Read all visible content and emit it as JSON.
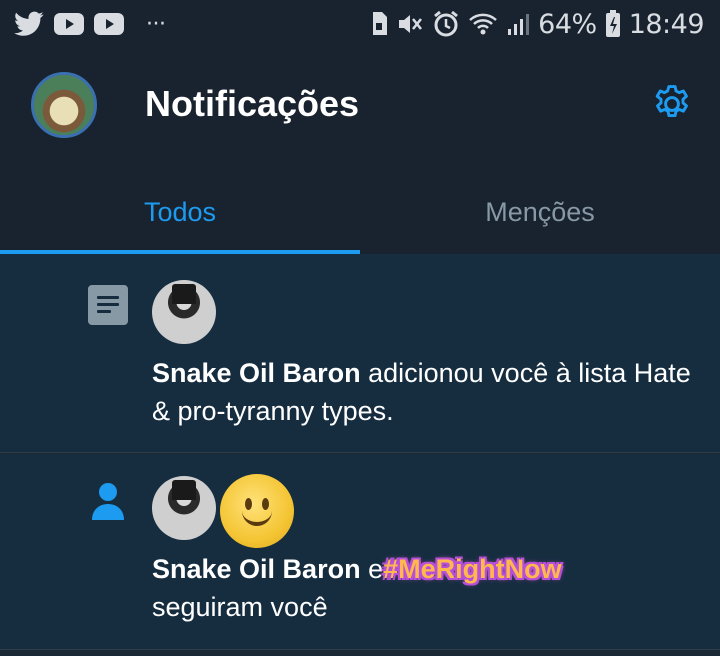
{
  "status_bar": {
    "battery_percent": "64%",
    "time": "18:49",
    "dots": "···"
  },
  "header": {
    "title": "Notificações",
    "tabs": [
      {
        "label": "Todos",
        "active": true
      },
      {
        "label": "Menções",
        "active": false
      }
    ]
  },
  "notifications": [
    {
      "user": "Snake Oil Baron",
      "text": " adicionou você à lista Hate & pro-tyranny types."
    },
    {
      "user": "Snake Oil Baron",
      "joiner": " e",
      "other_user": "#MeRightNow",
      "text": "seguiram você"
    }
  ],
  "colors": {
    "accent": "#1d9bf0",
    "background": "#1b2836",
    "header_bg": "#19232f",
    "muted": "#8899a6"
  }
}
